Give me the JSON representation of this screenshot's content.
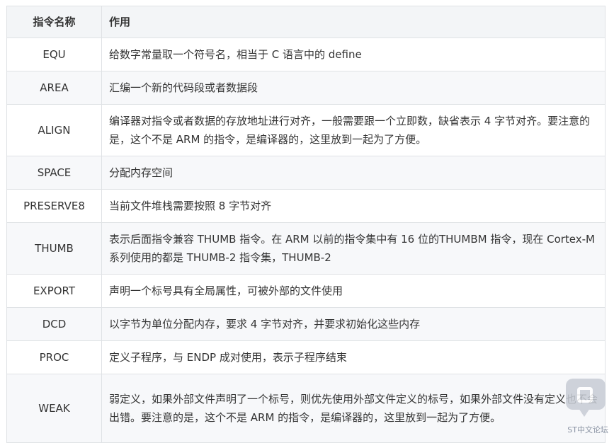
{
  "table": {
    "headers": [
      "指令名称",
      "作用"
    ],
    "rows": [
      {
        "cmd": "EQU",
        "desc": "给数字常量取一个符号名，相当于 C 语言中的 define"
      },
      {
        "cmd": "AREA",
        "desc": "汇编一个新的代码段或者数据段"
      },
      {
        "cmd": "ALIGN",
        "desc": "编译器对指令或者数据的存放地址进行对齐，一般需要跟一个立即数，缺省表示 4 字节对齐。要注意的是，这个不是 ARM 的指令，是编译器的，这里放到一起为了方便。"
      },
      {
        "cmd": "SPACE",
        "desc": "分配内存空间"
      },
      {
        "cmd": "PRESERVE8",
        "desc": "当前文件堆栈需要按照 8 字节对齐"
      },
      {
        "cmd": "THUMB",
        "desc": "表示后面指令兼容 THUMB 指令。在 ARM 以前的指令集中有 16 位的THUMBM 指令，现在 Cortex-M 系列使用的都是 THUMB-2 指令集，THUMB-2"
      },
      {
        "cmd": "EXPORT",
        "desc": "声明一个标号具有全局属性，可被外部的文件使用"
      },
      {
        "cmd": "DCD",
        "desc": "以字节为单位分配内存，要求 4 字节对齐，并要求初始化这些内存"
      },
      {
        "cmd": "PROC",
        "desc": "定义子程序，与 ENDP 成对使用，表示子程序结束"
      },
      {
        "cmd": "WEAK",
        "desc": "弱定义，如果外部文件声明了一个标号，则优先使用外部文件定义的标号，如果外部文件没有定义也不会出错。要注意的是，这个不是 ARM 的指令，是编译器的，这里放到一起为了方便。"
      }
    ]
  },
  "watermark": {
    "text": "ST中文论坛",
    "icon": "chat-bubble-logo-icon"
  }
}
